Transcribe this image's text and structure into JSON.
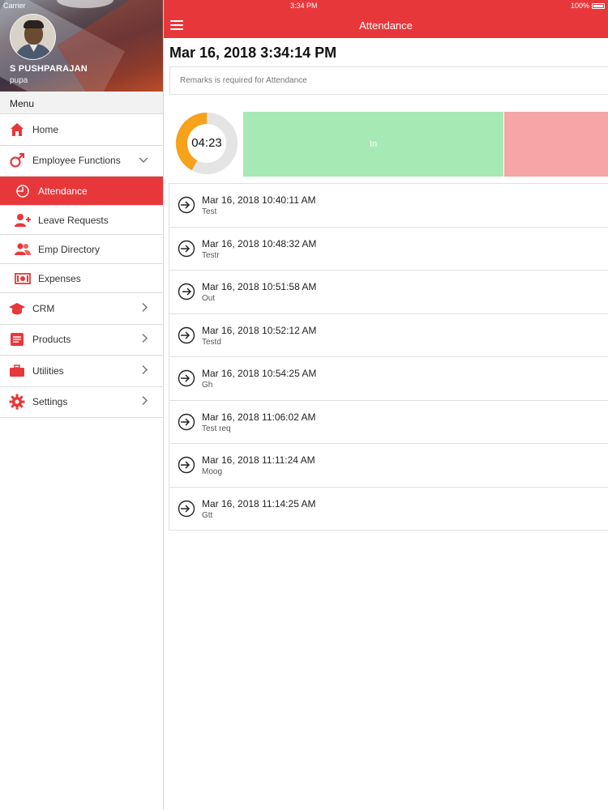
{
  "status_bar": {
    "carrier": "Carrier",
    "time": "3:34 PM",
    "battery": "100%"
  },
  "profile": {
    "name": "S PUSHPARAJAN",
    "username": "pupa"
  },
  "menu": {
    "header": "Menu",
    "items": [
      {
        "label": "Home",
        "icon": "home-icon"
      },
      {
        "label": "Employee Functions",
        "icon": "male-icon",
        "expanded": true,
        "children": [
          {
            "label": "Attendance",
            "icon": "clock-icon",
            "active": true
          },
          {
            "label": "Leave Requests",
            "icon": "add-user-icon"
          },
          {
            "label": "Emp Directory",
            "icon": "users-icon"
          },
          {
            "label": "Expenses",
            "icon": "money-icon"
          }
        ]
      },
      {
        "label": "CRM",
        "icon": "graduation-cap-icon"
      },
      {
        "label": "Products",
        "icon": "list-icon"
      },
      {
        "label": "Utilities",
        "icon": "briefcase-icon"
      },
      {
        "label": "Settings",
        "icon": "gear-icon"
      }
    ]
  },
  "header": {
    "title": "Attendance"
  },
  "main": {
    "datetime": "Mar 16, 2018 3:34:14 PM",
    "remarks_placeholder": "Remarks is required for Attendance",
    "timer": "04:23",
    "timer_progress": 0.42,
    "in_label": "In",
    "colors": {
      "accent": "#e8373a",
      "in": "#a6e9b4",
      "out": "#f6a6a6",
      "gauge": "#f7a21b"
    }
  },
  "entries": [
    {
      "time": "Mar 16, 2018 10:40:11 AM",
      "note": "Test",
      "type": "in"
    },
    {
      "time": "Mar 16, 2018 10:48:32 AM",
      "note": "Testr",
      "type": "in"
    },
    {
      "time": "Mar 16, 2018 10:51:58 AM",
      "note": "Out",
      "type": "out"
    },
    {
      "time": "Mar 16, 2018 10:52:12 AM",
      "note": "Testd",
      "type": "in"
    },
    {
      "time": "Mar 16, 2018 10:54:25 AM",
      "note": "Gh",
      "type": "in"
    },
    {
      "time": "Mar 16, 2018 11:06:02 AM",
      "note": "Test req",
      "type": "in"
    },
    {
      "time": "Mar 16, 2018 11:11:24 AM",
      "note": "Moog",
      "type": "in"
    },
    {
      "time": "Mar 16, 2018 11:14:25 AM",
      "note": "Gtt",
      "type": "in"
    }
  ]
}
